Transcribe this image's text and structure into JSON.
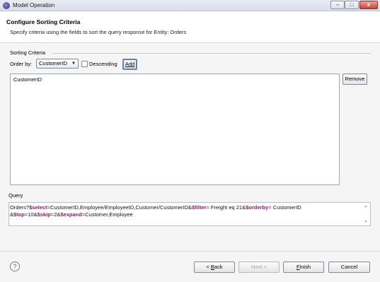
{
  "window": {
    "title": "Model Operation",
    "minimize": "–",
    "maximize": "□",
    "close": "x"
  },
  "header": {
    "title": "Configure Sorting Criteria",
    "description": "Specify criteria using the fields to sort the query response for Entity: Orders"
  },
  "sorting": {
    "group_label": "Sorting Criteria",
    "order_by_label": "Order by:",
    "order_by_value": "CustomerID",
    "descending_label": "Descending",
    "descending_checked": false,
    "add_label": "Add",
    "remove_label": "Remove",
    "items": [
      "CustomerID"
    ]
  },
  "query": {
    "label": "Query",
    "parts": {
      "p1": "Orders?",
      "select_kw": "$select",
      "select_val": "CustomerID,Employee/EmployeeID,Customer/CustomerID&",
      "filter_kw": "$filter",
      "filter_val": "Freight eq 21&",
      "orderby_kw": "$orderby",
      "orderby_val": "CustomerID",
      "p2": "&",
      "top_kw": "$top",
      "top_val": "10&",
      "skip_kw": "$skip",
      "skip_val": "2&",
      "expand_kw": "$expand",
      "expand_val": "Customer,Employee"
    }
  },
  "buttons": {
    "help": "?",
    "back_prefix": "< ",
    "back_mnemonic": "B",
    "back_rest": "ack",
    "next": "Next >",
    "finish_mnemonic": "F",
    "finish_rest": "inish",
    "cancel": "Cancel"
  }
}
